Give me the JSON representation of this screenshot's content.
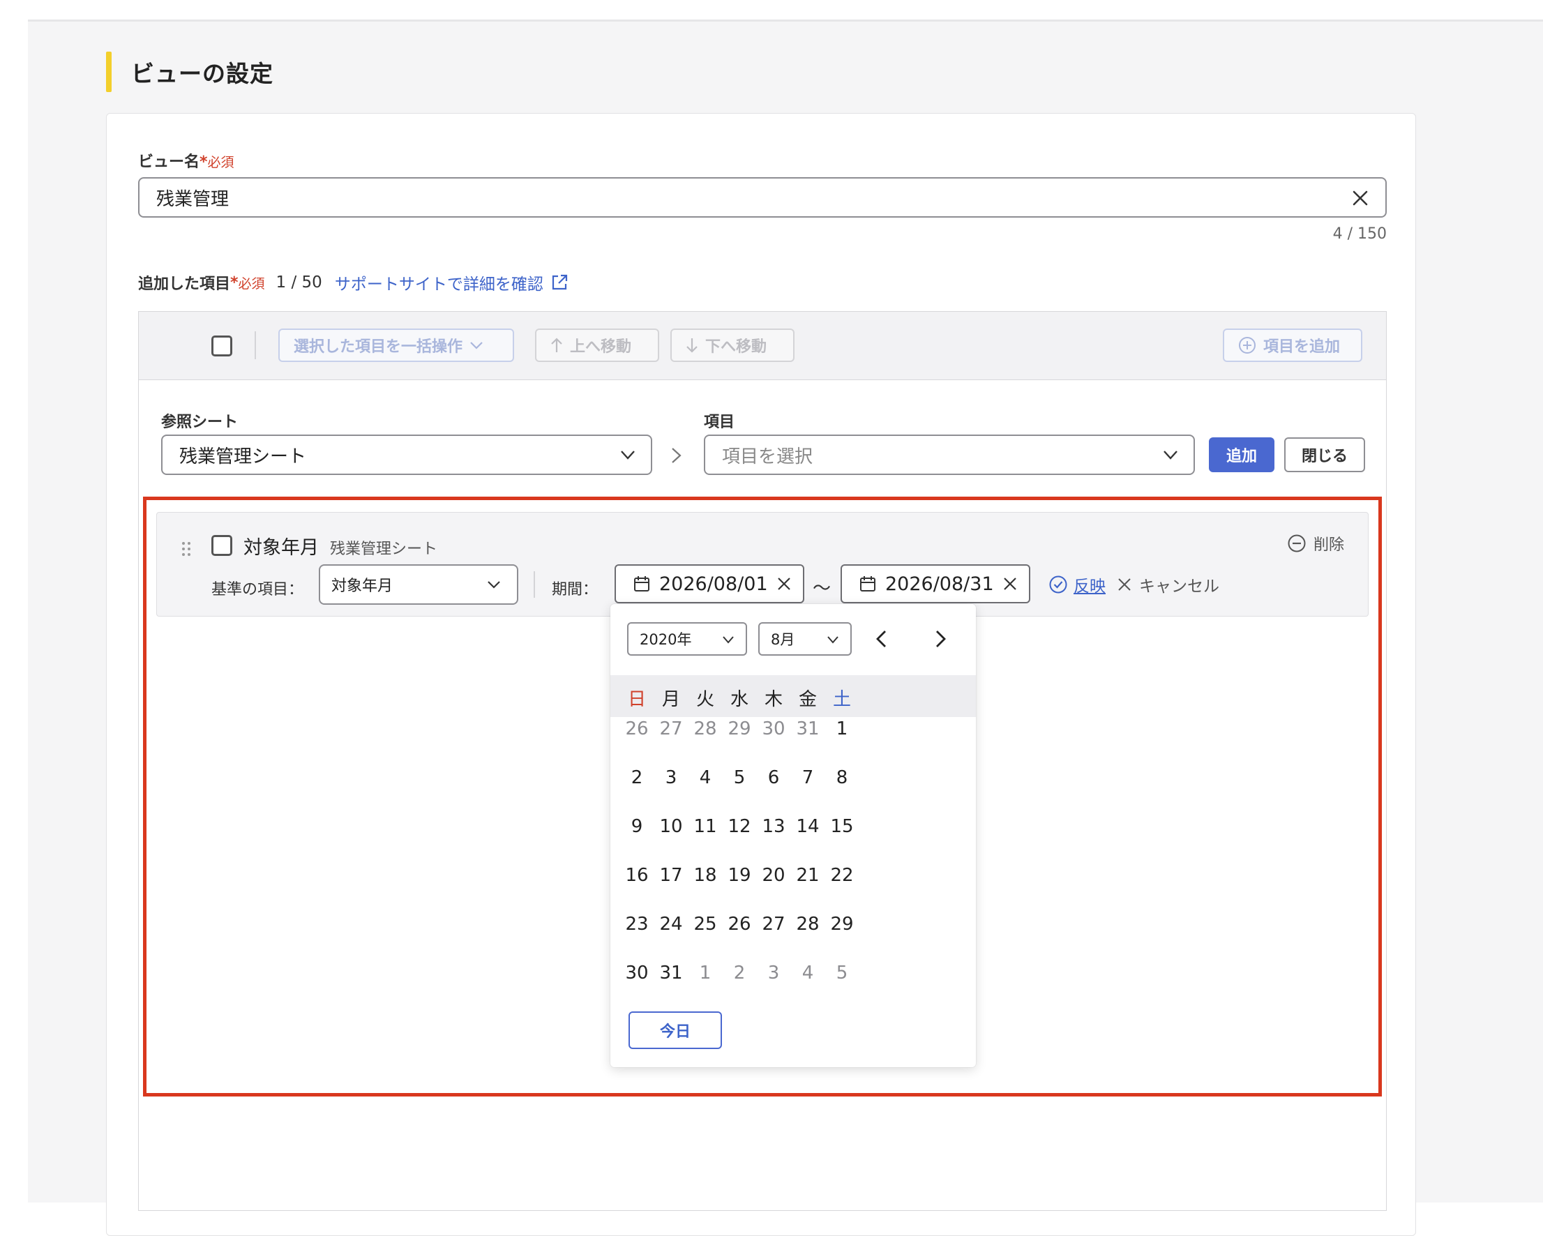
{
  "section": {
    "title": "ビューの設定"
  },
  "view_name": {
    "label": "ビュー名",
    "required_mark": "*",
    "required_text": "必須",
    "value": "残業管理",
    "counter": "4 / 150"
  },
  "added_items": {
    "label": "追加した項目",
    "required_mark": "*",
    "required_text": "必須",
    "count": "1 / 50",
    "support_link": "サポートサイトで詳細を確認"
  },
  "toolbar": {
    "bulk_action": "選択した項目を一括操作",
    "move_up": "上へ移動",
    "move_down": "下へ移動",
    "add_item": "項目を追加"
  },
  "add_form": {
    "sheet_label": "参照シート",
    "sheet_value": "残業管理シート",
    "item_label": "項目",
    "item_placeholder": "項目を選択",
    "add_button": "追加",
    "close_button": "閉じる"
  },
  "item": {
    "name": "対象年月",
    "sheet": "残業管理シート",
    "delete": "削除",
    "base_label": "基準の項目：",
    "base_value": "対象年月",
    "period_label": "期間：",
    "start_date": "2026/08/01",
    "tilde": "〜",
    "end_date": "2026/08/31",
    "apply": "反映",
    "cancel": "キャンセル"
  },
  "calendar": {
    "year": "2020年",
    "month": "8月",
    "weekdays": [
      "日",
      "月",
      "火",
      "水",
      "木",
      "金",
      "土"
    ],
    "weeks": [
      [
        "26",
        "27",
        "28",
        "29",
        "30",
        "31",
        "1"
      ],
      [
        "2",
        "3",
        "4",
        "5",
        "6",
        "7",
        "8"
      ],
      [
        "9",
        "10",
        "11",
        "12",
        "13",
        "14",
        "15"
      ],
      [
        "16",
        "17",
        "18",
        "19",
        "20",
        "21",
        "22"
      ],
      [
        "23",
        "24",
        "25",
        "26",
        "27",
        "28",
        "29"
      ],
      [
        "30",
        "31",
        "1",
        "2",
        "3",
        "4",
        "5"
      ]
    ],
    "other_month_days": {
      "0": [
        0,
        1,
        2,
        3,
        4,
        5
      ],
      "5": [
        2,
        3,
        4,
        5,
        6
      ]
    },
    "today_button": "今日"
  },
  "colors": {
    "accent": "#4a68d0",
    "required": "#d0412b",
    "highlight_border": "#d9381e",
    "title_bar": "#f3cf2b"
  }
}
